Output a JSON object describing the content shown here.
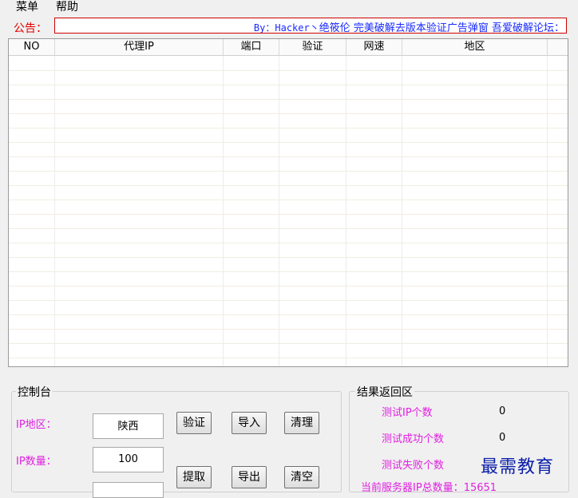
{
  "menu": {
    "items": [
      "菜单",
      "帮助"
    ]
  },
  "notice": {
    "label": "公告：",
    "text_prefix": "By：Hacker丶",
    "text_body": "绝筱伦 完美破解去版本验证广告弹窗 吾爱破解论坛："
  },
  "grid": {
    "columns": [
      "NO",
      "代理IP",
      "端口",
      "验证",
      "网速",
      "地区"
    ],
    "rows": []
  },
  "console": {
    "title": "控制台",
    "region_label": "IP地区：",
    "region_value": "陕西",
    "count_label": "IP数量：",
    "count_value": "100",
    "buttons": {
      "verify": "验证",
      "import": "导入",
      "clean": "清理",
      "fetch": "提取",
      "export": "导出",
      "clear": "清空"
    }
  },
  "results": {
    "title": "结果返回区",
    "tested_label": "测试IP个数",
    "tested_value": "0",
    "success_label": "测试成功个数",
    "success_value": "0",
    "fail_label": "测试失败个数",
    "server_total_label": "当前服务器IP总数量：",
    "server_total_value": "15651"
  },
  "watermark": "最需教育",
  "colors": {
    "notice_label": "#e00000",
    "notice_text": "#1a2aff",
    "magenta": "#e020e0"
  }
}
